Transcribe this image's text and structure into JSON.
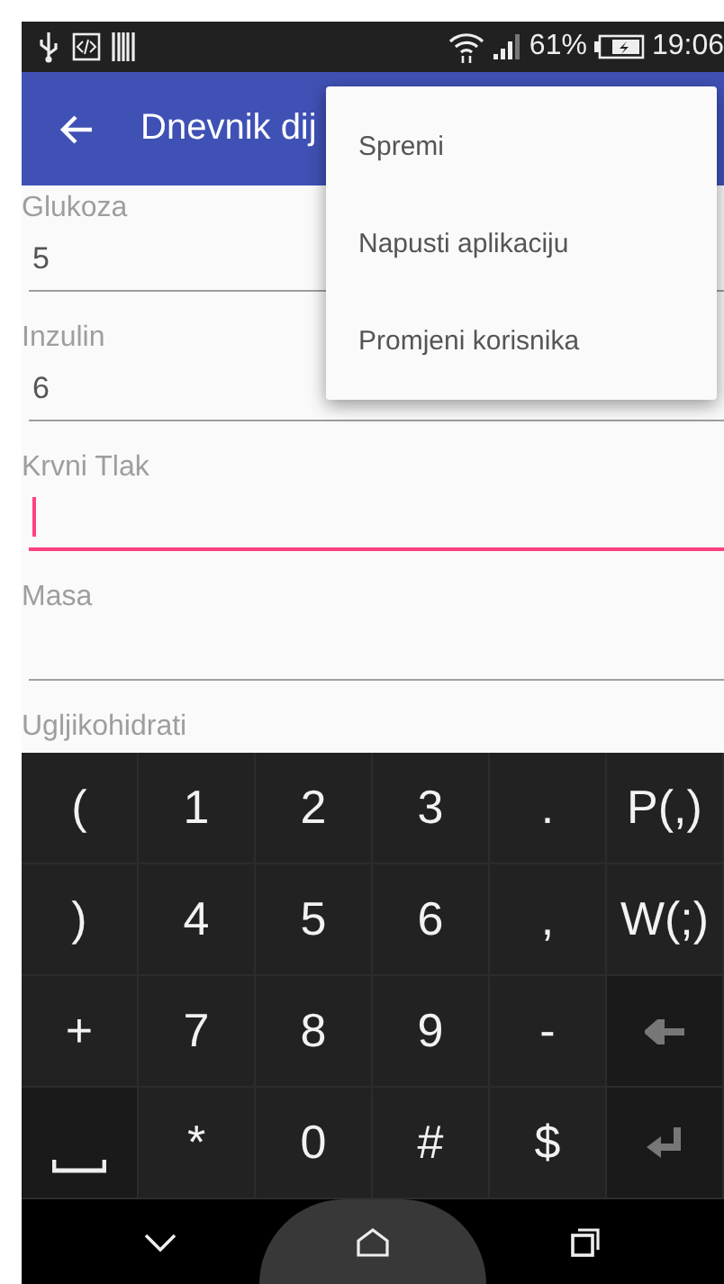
{
  "status_bar": {
    "battery_percent": "61%",
    "time": "19:06"
  },
  "app_bar": {
    "title": "Dnevnik dij"
  },
  "fields": [
    {
      "label": "Glukoza",
      "value": "5",
      "focused": false
    },
    {
      "label": "Inzulin",
      "value": "6",
      "focused": false
    },
    {
      "label": "Krvni Tlak",
      "focused": true
    },
    {
      "label": "Masa",
      "focused": false
    },
    {
      "label": "Ugljikohidrati"
    }
  ],
  "menu": {
    "items": [
      "Spremi",
      "Napusti aplikaciju",
      "Promjeni korisnika"
    ]
  },
  "keyboard": {
    "rows": [
      [
        {
          "kind": "char",
          "label": "("
        },
        {
          "kind": "char",
          "label": "1"
        },
        {
          "kind": "char",
          "label": "2"
        },
        {
          "kind": "char",
          "label": "3"
        },
        {
          "kind": "char",
          "label": "."
        },
        {
          "kind": "char",
          "label": "P(,)"
        }
      ],
      [
        {
          "kind": "char",
          "label": ")"
        },
        {
          "kind": "char",
          "label": "4"
        },
        {
          "kind": "char",
          "label": "5"
        },
        {
          "kind": "char",
          "label": "6"
        },
        {
          "kind": "char",
          "label": ","
        },
        {
          "kind": "char",
          "label": "W(;)"
        }
      ],
      [
        {
          "kind": "char",
          "label": "+"
        },
        {
          "kind": "char",
          "label": "7"
        },
        {
          "kind": "char",
          "label": "8"
        },
        {
          "kind": "char",
          "label": "9"
        },
        {
          "kind": "char",
          "label": "-"
        },
        {
          "kind": "backspace"
        }
      ],
      [
        {
          "kind": "space"
        },
        {
          "kind": "char",
          "label": "*"
        },
        {
          "kind": "char",
          "label": "0"
        },
        {
          "kind": "char",
          "label": "#"
        },
        {
          "kind": "char",
          "label": "$"
        },
        {
          "kind": "enter"
        }
      ]
    ]
  }
}
